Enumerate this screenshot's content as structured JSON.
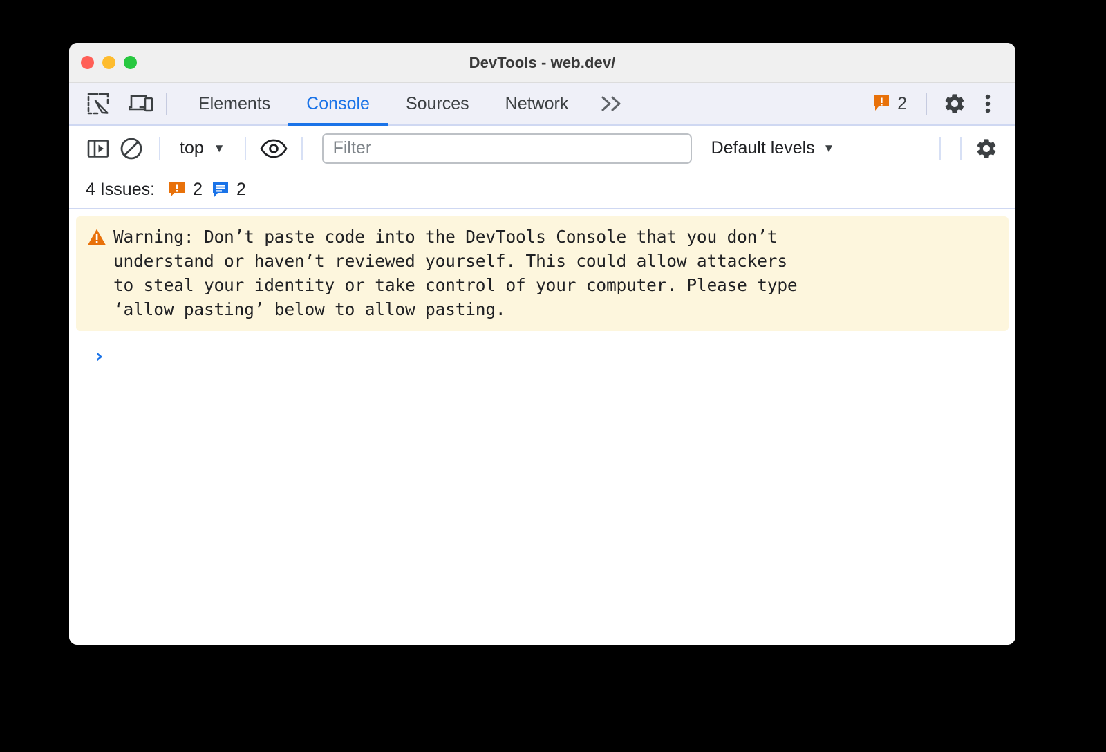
{
  "window": {
    "title": "DevTools - web.dev/",
    "traffic_lights": [
      "close",
      "minimize",
      "maximize"
    ]
  },
  "tabbar": {
    "inspect_icon": "inspect-element-icon",
    "device_icon": "device-toolbar-icon",
    "tabs": [
      {
        "label": "Elements",
        "active": false
      },
      {
        "label": "Console",
        "active": true
      },
      {
        "label": "Sources",
        "active": false
      },
      {
        "label": "Network",
        "active": false
      }
    ],
    "overflow_label": "»",
    "warning_badge": {
      "icon": "warning-bubble-icon",
      "count": "2",
      "color": "#e8710a"
    },
    "settings_icon": "gear-icon",
    "more_icon": "three-dot-menu-icon"
  },
  "console_toolbar": {
    "sidebar_toggle_icon": "console-sidebar-icon",
    "clear_icon": "clear-console-icon",
    "context": {
      "label": "top",
      "caret": "▼"
    },
    "eye_icon": "live-expression-eye-icon",
    "filter": {
      "placeholder": "Filter",
      "value": ""
    },
    "levels": {
      "label": "Default levels",
      "caret": "▼"
    },
    "settings_icon": "console-settings-gear-icon"
  },
  "issues_bar": {
    "label": "4 Issues:",
    "items": [
      {
        "icon": "warning-bubble-icon",
        "count": "2",
        "color": "#e8710a"
      },
      {
        "icon": "info-bubble-icon",
        "count": "2",
        "color": "#1a73e8"
      }
    ]
  },
  "console": {
    "messages": [
      {
        "level": "warning",
        "icon": "warning-triangle-icon",
        "text": "Warning: Don’t paste code into the DevTools Console that you don’t\nunderstand or haven’t reviewed yourself. This could allow attackers\nto steal your identity or take control of your computer. Please type\n‘allow pasting’ below to allow pasting.",
        "bg_color": "#fdf6dd"
      }
    ],
    "prompt": {
      "chevron": "›",
      "value": "",
      "color": "#1a73e8"
    }
  },
  "colors": {
    "accent": "#1a73e8",
    "warning": "#e8710a",
    "tabbar_bg": "#eff0f8",
    "window_bg": "#ffffff",
    "page_bg": "#000000"
  }
}
